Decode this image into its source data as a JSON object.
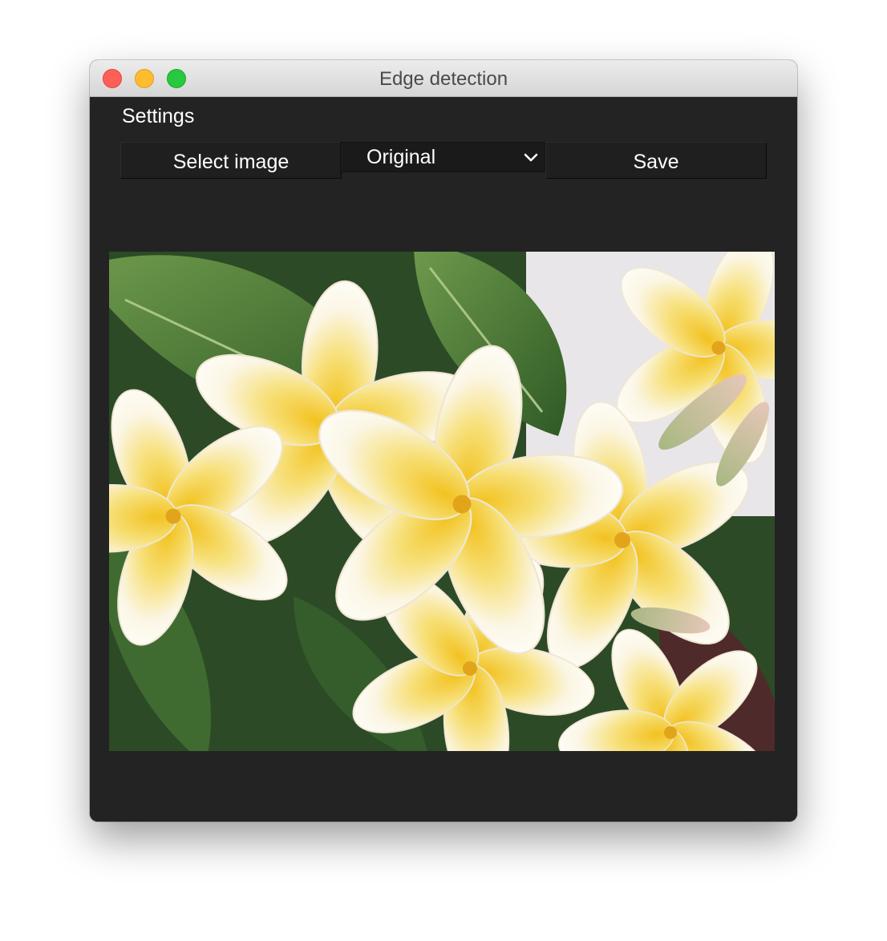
{
  "window": {
    "title": "Edge detection"
  },
  "settings": {
    "label": "Settings"
  },
  "toolbar": {
    "select_image_label": "Select image",
    "mode_selected": "Original",
    "save_label": "Save"
  },
  "colors": {
    "background": "#232323",
    "button": "#1f1f1f",
    "text": "#ffffff",
    "close": "#fe5f57",
    "minimize": "#febc2e",
    "zoom": "#28c840"
  },
  "icons": {
    "dropdown": "chevron-down-icon"
  }
}
